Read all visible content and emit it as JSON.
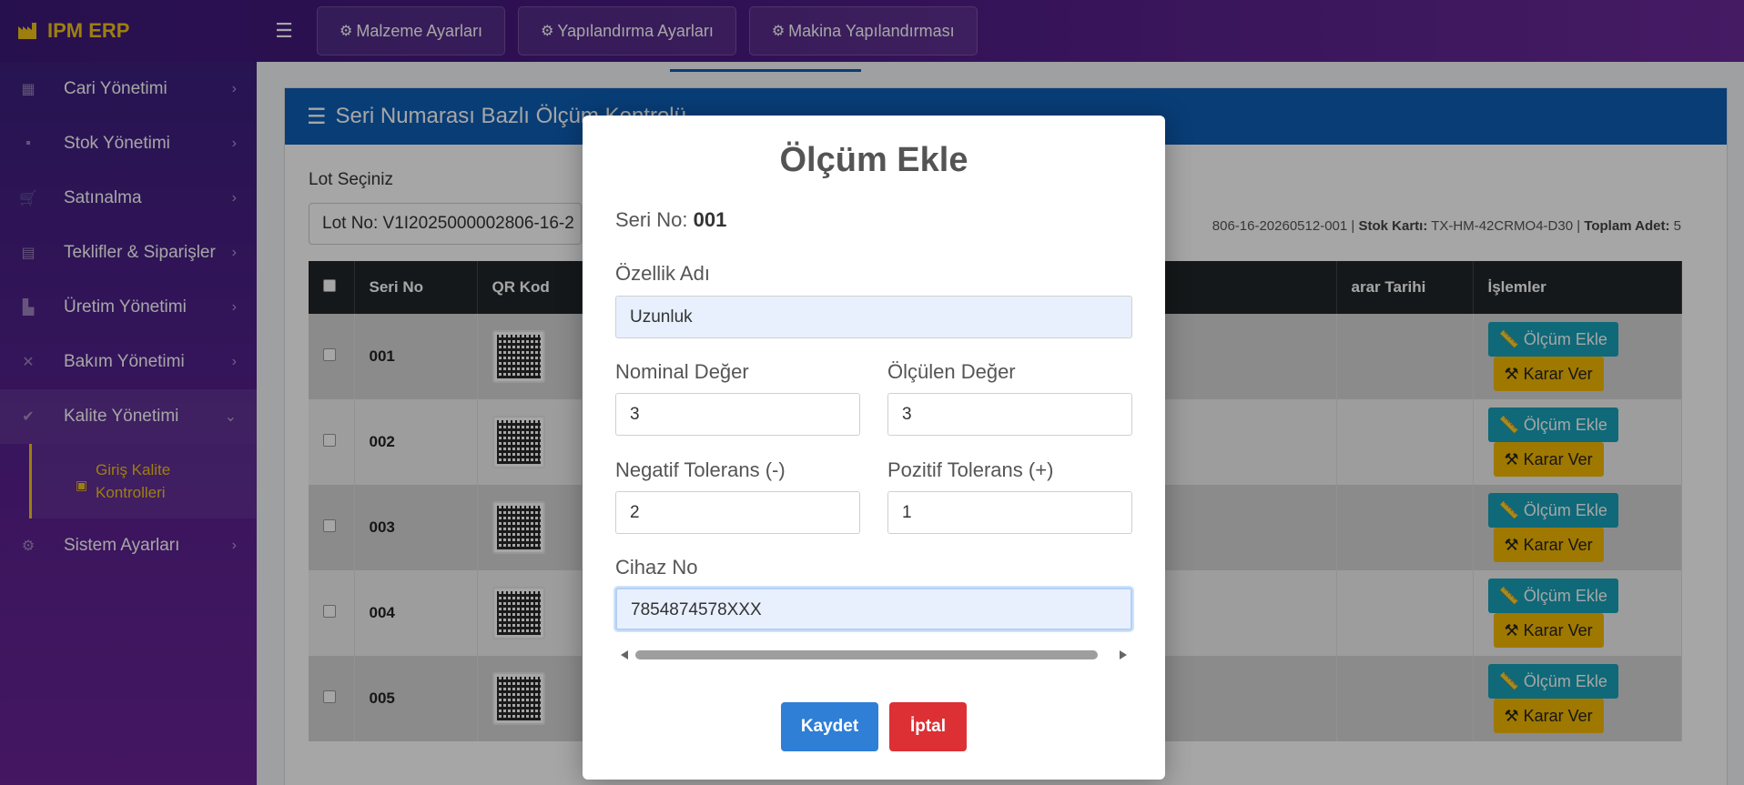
{
  "brand": {
    "name": "IPM ERP"
  },
  "topnav": [
    {
      "label": "Malzeme Ayarları",
      "icon": "cogs-icon"
    },
    {
      "label": "Yapılandırma Ayarları",
      "icon": "cog-icon"
    },
    {
      "label": "Makina Yapılandırması",
      "icon": "cogs-icon"
    }
  ],
  "sidebar": {
    "items": [
      {
        "label": "Cari Yönetimi"
      },
      {
        "label": "Stok Yönetimi"
      },
      {
        "label": "Satınalma"
      },
      {
        "label": "Teklifler & Siparişler"
      },
      {
        "label": "Üretim Yönetimi"
      },
      {
        "label": "Bakım Yönetimi"
      },
      {
        "label": "Kalite Yönetimi"
      },
      {
        "label": "Sistem Ayarları"
      }
    ],
    "sub": {
      "line1": "Giriş Kalite",
      "line2": "Kontrolleri"
    }
  },
  "page": {
    "card_title": "Seri Numarası Bazlı Ölçüm Kontrolü",
    "lot_label": "Lot Seçiniz",
    "lot_value": "Lot No: V1I2025000002806-16-2",
    "lot_info": {
      "lot_tail": "806-16-20260512-001 |",
      "stok_label": "Stok Kartı:",
      "stok_value": "TX-HM-42CRMO4-D30 |",
      "toplam_label": "Toplam Adet:",
      "toplam_value": "5"
    },
    "table": {
      "headers": [
        "Seri No",
        "QR Kod",
        "",
        "arar Tarihi",
        "İşlemler"
      ],
      "rows": [
        {
          "seri": "001"
        },
        {
          "seri": "002"
        },
        {
          "seri": "003"
        },
        {
          "seri": "004"
        },
        {
          "seri": "005"
        }
      ],
      "olcum_label": "Ölçüm Ekle",
      "karar_label": "Karar Ver"
    }
  },
  "modal": {
    "title": "Ölçüm Ekle",
    "seri_label": "Seri No:",
    "seri_value": "001",
    "ozellik_label": "Özellik Adı",
    "ozellik_value": "Uzunluk",
    "nominal_label": "Nominal Değer",
    "nominal_value": "3",
    "olculen_label": "Ölçülen Değer",
    "olculen_value": "3",
    "negatif_label": "Negatif Tolerans (-)",
    "negatif_value": "2",
    "pozitif_label": "Pozitif Tolerans (+)",
    "pozitif_value": "1",
    "cihaz_label": "Cihaz No",
    "cihaz_value": "7854874578XXX",
    "save_label": "Kaydet",
    "cancel_label": "İptal"
  },
  "colors": {
    "primary": "#0d5fb6",
    "accent": "#f0c419",
    "info": "#17a2b8",
    "warning": "#f5b800",
    "danger": "#dc3035"
  }
}
